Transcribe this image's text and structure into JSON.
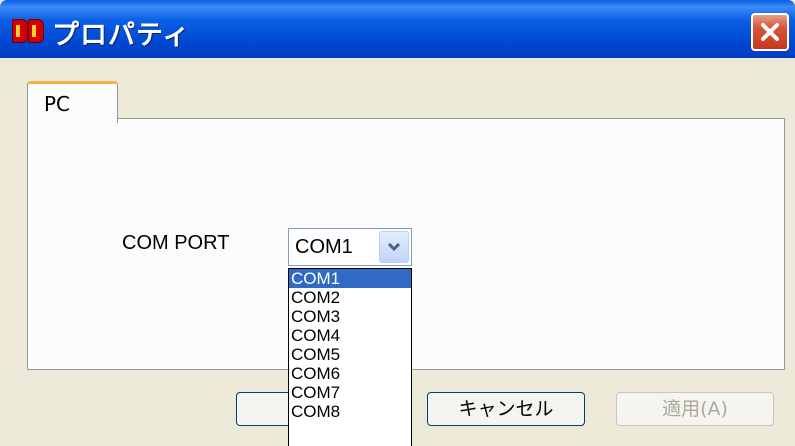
{
  "window": {
    "title": "プロパティ",
    "icon": "app-logo-icon",
    "close_icon": "close-icon"
  },
  "tabs": [
    {
      "label": "PC",
      "active": true
    }
  ],
  "form": {
    "com_port_label": "COM PORT",
    "com_port_value": "COM1",
    "dropdown_icon": "chevron-down-icon",
    "options": [
      "COM1",
      "COM2",
      "COM3",
      "COM4",
      "COM5",
      "COM6",
      "COM7",
      "COM8"
    ],
    "highlighted_option": "COM1"
  },
  "buttons": {
    "ok_label": "",
    "cancel_label": "キャンセル",
    "apply_label": "適用(A)",
    "apply_enabled": false
  },
  "colors": {
    "titlebar": "#0a5fe5",
    "selection": "#316ac5",
    "tab_accent": "#f3b34b",
    "close_button": "#c4381a"
  }
}
